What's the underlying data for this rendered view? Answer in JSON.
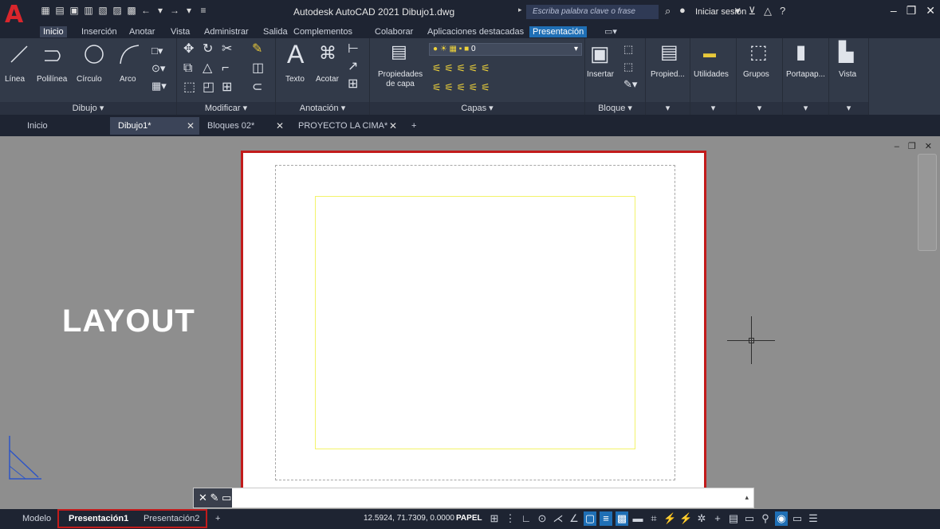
{
  "titlebar": {
    "app_title": "Autodesk AutoCAD 2021   Dibujo1.dwg",
    "search_placeholder": "Escriba palabra clave o frase",
    "signin": "Iniciar sesión"
  },
  "ribbon_tabs": [
    "Inicio",
    "Inserción",
    "Anotar",
    "Vista",
    "Administrar",
    "Salida",
    "Complementos",
    "Colaborar",
    "Aplicaciones destacadas",
    "Presentación"
  ],
  "ribbon": {
    "dibujo": {
      "title": "Dibujo",
      "tools": [
        "Línea",
        "Polilínea",
        "Círculo",
        "Arco"
      ]
    },
    "modificar": {
      "title": "Modificar"
    },
    "anotacion": {
      "title": "Anotación",
      "tools": [
        "Texto",
        "Acotar"
      ]
    },
    "capas": {
      "title": "Capas",
      "props_line1": "Propiedades",
      "props_line2": "de capa",
      "layer_value": "0"
    },
    "bloque": {
      "title": "Bloque",
      "insert": "Insertar"
    },
    "extra": [
      "Propied...",
      "Utilidades",
      "Grupos",
      "Portapap...",
      "Vista"
    ]
  },
  "doc_tabs": [
    "Inicio",
    "Dibujo1*",
    "Bloques 02*",
    "PROYECTO LA CIMA*"
  ],
  "canvas": {
    "overlay_label": "LAYOUT"
  },
  "status": {
    "tabs": [
      "Modelo",
      "Presentación1",
      "Presentación2"
    ],
    "coords": "12.5924, 71.7309, 0.0000",
    "space": "PAPEL"
  },
  "colors": {
    "highlight": "#c21b1b",
    "accent": "#1f6fb5",
    "viewport": "#f3f36a"
  }
}
